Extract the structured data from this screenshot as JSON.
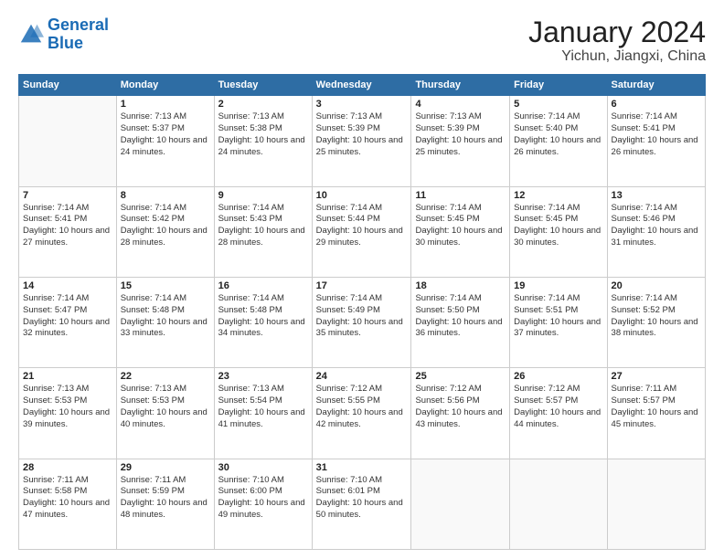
{
  "logo": {
    "line1": "General",
    "line2": "Blue"
  },
  "title": "January 2024",
  "subtitle": "Yichun, Jiangxi, China",
  "weekdays": [
    "Sunday",
    "Monday",
    "Tuesday",
    "Wednesday",
    "Thursday",
    "Friday",
    "Saturday"
  ],
  "weeks": [
    [
      {
        "day": "",
        "sunrise": "",
        "sunset": "",
        "daylight": ""
      },
      {
        "day": "1",
        "sunrise": "Sunrise: 7:13 AM",
        "sunset": "Sunset: 5:37 PM",
        "daylight": "Daylight: 10 hours and 24 minutes."
      },
      {
        "day": "2",
        "sunrise": "Sunrise: 7:13 AM",
        "sunset": "Sunset: 5:38 PM",
        "daylight": "Daylight: 10 hours and 24 minutes."
      },
      {
        "day": "3",
        "sunrise": "Sunrise: 7:13 AM",
        "sunset": "Sunset: 5:39 PM",
        "daylight": "Daylight: 10 hours and 25 minutes."
      },
      {
        "day": "4",
        "sunrise": "Sunrise: 7:13 AM",
        "sunset": "Sunset: 5:39 PM",
        "daylight": "Daylight: 10 hours and 25 minutes."
      },
      {
        "day": "5",
        "sunrise": "Sunrise: 7:14 AM",
        "sunset": "Sunset: 5:40 PM",
        "daylight": "Daylight: 10 hours and 26 minutes."
      },
      {
        "day": "6",
        "sunrise": "Sunrise: 7:14 AM",
        "sunset": "Sunset: 5:41 PM",
        "daylight": "Daylight: 10 hours and 26 minutes."
      }
    ],
    [
      {
        "day": "7",
        "sunrise": "Sunrise: 7:14 AM",
        "sunset": "Sunset: 5:41 PM",
        "daylight": "Daylight: 10 hours and 27 minutes."
      },
      {
        "day": "8",
        "sunrise": "Sunrise: 7:14 AM",
        "sunset": "Sunset: 5:42 PM",
        "daylight": "Daylight: 10 hours and 28 minutes."
      },
      {
        "day": "9",
        "sunrise": "Sunrise: 7:14 AM",
        "sunset": "Sunset: 5:43 PM",
        "daylight": "Daylight: 10 hours and 28 minutes."
      },
      {
        "day": "10",
        "sunrise": "Sunrise: 7:14 AM",
        "sunset": "Sunset: 5:44 PM",
        "daylight": "Daylight: 10 hours and 29 minutes."
      },
      {
        "day": "11",
        "sunrise": "Sunrise: 7:14 AM",
        "sunset": "Sunset: 5:45 PM",
        "daylight": "Daylight: 10 hours and 30 minutes."
      },
      {
        "day": "12",
        "sunrise": "Sunrise: 7:14 AM",
        "sunset": "Sunset: 5:45 PM",
        "daylight": "Daylight: 10 hours and 30 minutes."
      },
      {
        "day": "13",
        "sunrise": "Sunrise: 7:14 AM",
        "sunset": "Sunset: 5:46 PM",
        "daylight": "Daylight: 10 hours and 31 minutes."
      }
    ],
    [
      {
        "day": "14",
        "sunrise": "Sunrise: 7:14 AM",
        "sunset": "Sunset: 5:47 PM",
        "daylight": "Daylight: 10 hours and 32 minutes."
      },
      {
        "day": "15",
        "sunrise": "Sunrise: 7:14 AM",
        "sunset": "Sunset: 5:48 PM",
        "daylight": "Daylight: 10 hours and 33 minutes."
      },
      {
        "day": "16",
        "sunrise": "Sunrise: 7:14 AM",
        "sunset": "Sunset: 5:48 PM",
        "daylight": "Daylight: 10 hours and 34 minutes."
      },
      {
        "day": "17",
        "sunrise": "Sunrise: 7:14 AM",
        "sunset": "Sunset: 5:49 PM",
        "daylight": "Daylight: 10 hours and 35 minutes."
      },
      {
        "day": "18",
        "sunrise": "Sunrise: 7:14 AM",
        "sunset": "Sunset: 5:50 PM",
        "daylight": "Daylight: 10 hours and 36 minutes."
      },
      {
        "day": "19",
        "sunrise": "Sunrise: 7:14 AM",
        "sunset": "Sunset: 5:51 PM",
        "daylight": "Daylight: 10 hours and 37 minutes."
      },
      {
        "day": "20",
        "sunrise": "Sunrise: 7:14 AM",
        "sunset": "Sunset: 5:52 PM",
        "daylight": "Daylight: 10 hours and 38 minutes."
      }
    ],
    [
      {
        "day": "21",
        "sunrise": "Sunrise: 7:13 AM",
        "sunset": "Sunset: 5:53 PM",
        "daylight": "Daylight: 10 hours and 39 minutes."
      },
      {
        "day": "22",
        "sunrise": "Sunrise: 7:13 AM",
        "sunset": "Sunset: 5:53 PM",
        "daylight": "Daylight: 10 hours and 40 minutes."
      },
      {
        "day": "23",
        "sunrise": "Sunrise: 7:13 AM",
        "sunset": "Sunset: 5:54 PM",
        "daylight": "Daylight: 10 hours and 41 minutes."
      },
      {
        "day": "24",
        "sunrise": "Sunrise: 7:12 AM",
        "sunset": "Sunset: 5:55 PM",
        "daylight": "Daylight: 10 hours and 42 minutes."
      },
      {
        "day": "25",
        "sunrise": "Sunrise: 7:12 AM",
        "sunset": "Sunset: 5:56 PM",
        "daylight": "Daylight: 10 hours and 43 minutes."
      },
      {
        "day": "26",
        "sunrise": "Sunrise: 7:12 AM",
        "sunset": "Sunset: 5:57 PM",
        "daylight": "Daylight: 10 hours and 44 minutes."
      },
      {
        "day": "27",
        "sunrise": "Sunrise: 7:11 AM",
        "sunset": "Sunset: 5:57 PM",
        "daylight": "Daylight: 10 hours and 45 minutes."
      }
    ],
    [
      {
        "day": "28",
        "sunrise": "Sunrise: 7:11 AM",
        "sunset": "Sunset: 5:58 PM",
        "daylight": "Daylight: 10 hours and 47 minutes."
      },
      {
        "day": "29",
        "sunrise": "Sunrise: 7:11 AM",
        "sunset": "Sunset: 5:59 PM",
        "daylight": "Daylight: 10 hours and 48 minutes."
      },
      {
        "day": "30",
        "sunrise": "Sunrise: 7:10 AM",
        "sunset": "Sunset: 6:00 PM",
        "daylight": "Daylight: 10 hours and 49 minutes."
      },
      {
        "day": "31",
        "sunrise": "Sunrise: 7:10 AM",
        "sunset": "Sunset: 6:01 PM",
        "daylight": "Daylight: 10 hours and 50 minutes."
      },
      {
        "day": "",
        "sunrise": "",
        "sunset": "",
        "daylight": ""
      },
      {
        "day": "",
        "sunrise": "",
        "sunset": "",
        "daylight": ""
      },
      {
        "day": "",
        "sunrise": "",
        "sunset": "",
        "daylight": ""
      }
    ]
  ]
}
